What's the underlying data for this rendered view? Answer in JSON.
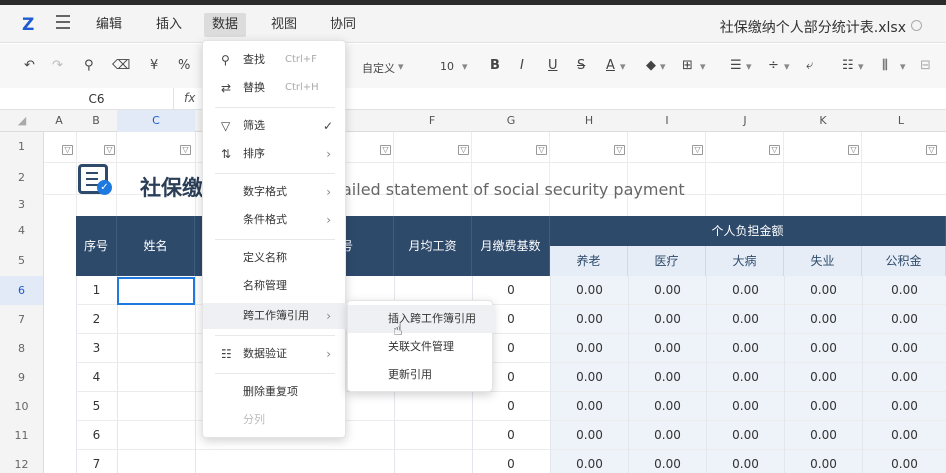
{
  "app": {
    "logo": "Z",
    "filename": "社保缴纳个人部分统计表.xlsx"
  },
  "menubar": {
    "items": [
      "编辑",
      "插入",
      "数据",
      "视图",
      "协同"
    ],
    "active": "数据"
  },
  "toolbar": {
    "currency": "¥",
    "percent": "%",
    "format": "自定义",
    "font_size": "10",
    "bold": "B",
    "italic": "I",
    "underline": "U",
    "strike": "S",
    "font_color": "A"
  },
  "formula_bar": {
    "cell_ref": "C6",
    "fx_label": "fx"
  },
  "columns": [
    "A",
    "B",
    "C",
    "F",
    "G",
    "H",
    "I",
    "J",
    "K",
    "L"
  ],
  "rows": [
    "1",
    "2",
    "3",
    "4",
    "5",
    "6",
    "7",
    "8",
    "9",
    "10",
    "11",
    "12"
  ],
  "sheet": {
    "title_cn": "社保缴",
    "title_en": "ailed statement of social security payment",
    "headers": {
      "seq": "序号",
      "name": "姓名",
      "id_no": "号",
      "avg_salary": "月均工资",
      "base": "月缴费基数",
      "personal_group": "个人负担金额",
      "pension": "养老",
      "medical": "医疗",
      "serious_illness": "大病",
      "unemployment": "失业",
      "housing_fund": "公积金"
    },
    "rows": [
      {
        "seq": "1",
        "base": "0",
        "vals": [
          "0.00",
          "0.00",
          "0.00",
          "0.00",
          "0.00"
        ]
      },
      {
        "seq": "2",
        "base": "0",
        "vals": [
          "0.00",
          "0.00",
          "0.00",
          "0.00",
          "0.00"
        ]
      },
      {
        "seq": "3",
        "base": "0",
        "vals": [
          "0.00",
          "0.00",
          "0.00",
          "0.00",
          "0.00"
        ]
      },
      {
        "seq": "4",
        "base": "0",
        "vals": [
          "0.00",
          "0.00",
          "0.00",
          "0.00",
          "0.00"
        ]
      },
      {
        "seq": "5",
        "base": "0",
        "vals": [
          "0.00",
          "0.00",
          "0.00",
          "0.00",
          "0.00"
        ]
      },
      {
        "seq": "6",
        "base": "0",
        "vals": [
          "0.00",
          "0.00",
          "0.00",
          "0.00",
          "0.00"
        ]
      },
      {
        "seq": "7",
        "base": "0",
        "vals": [
          "0.00",
          "0.00",
          "0.00",
          "0.00",
          "0.00"
        ]
      }
    ]
  },
  "data_menu": {
    "find": "查找",
    "find_shortcut": "Ctrl+F",
    "replace": "替换",
    "replace_shortcut": "Ctrl+H",
    "filter": "筛选",
    "sort": "排序",
    "number_format": "数字格式",
    "conditional_format": "条件格式",
    "define_name": "定义名称",
    "name_manager": "名称管理",
    "cross_workbook_ref": "跨工作簿引用",
    "data_validation": "数据验证",
    "remove_duplicates": "删除重复项",
    "split_column": "分列"
  },
  "submenu": {
    "insert_ref": "插入跨工作簿引用",
    "linked_files": "关联文件管理",
    "update_ref": "更新引用"
  },
  "colors": {
    "header_dark": "#2e4a6b",
    "header_light": "#e6edf6",
    "accent": "#1f7ae0"
  }
}
